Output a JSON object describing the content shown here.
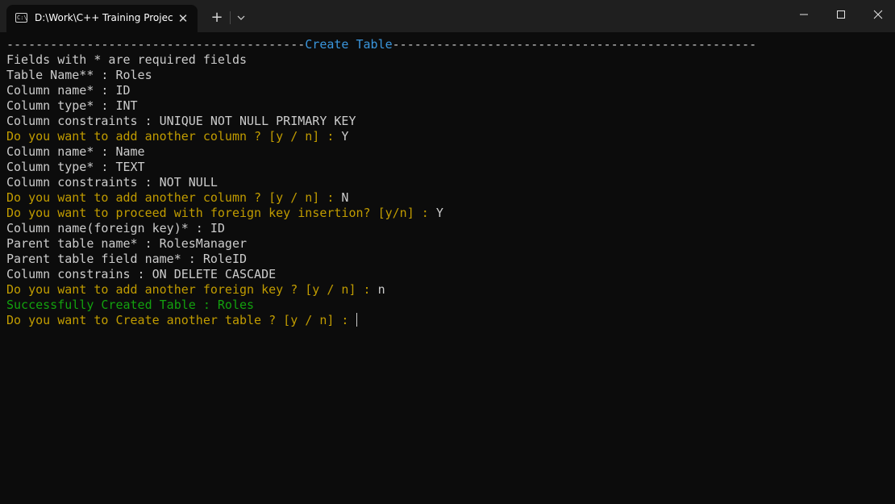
{
  "window": {
    "tab_title": "D:\\Work\\C++ Training Project",
    "tab_icon": "terminal-icon",
    "tab_icon_glyph": "C:\\",
    "close_tab_glyph": "✕",
    "new_tab_glyph": "+",
    "controls": [
      "minimize-icon",
      "maximize-icon",
      "close-icon"
    ]
  },
  "colors": {
    "background": "#0c0c0c",
    "titlebar": "#1f1f1f",
    "text": "#cccccc",
    "prompt_yellow": "#c19c00",
    "success_green": "#13a10e",
    "header_blue": "#3a96dd"
  },
  "terminal": {
    "header": {
      "left_rule": "-----------------------------------------",
      "title": "Create Table",
      "right_rule": "--------------------------------------------------"
    },
    "lines": [
      {
        "label": "Fields with * are required fields",
        "value": ""
      },
      {
        "label": "Table Name** : ",
        "value": "Roles"
      },
      {
        "label": "Column name* : ",
        "value": "ID"
      },
      {
        "label": "Column type* : ",
        "value": "INT"
      },
      {
        "label": "Column constraints : ",
        "value": "UNIQUE NOT NULL PRIMARY KEY"
      },
      {
        "label": "Do you want to add another column ? [y / n] : ",
        "value": "Y"
      },
      {
        "label": "Column name* : ",
        "value": "Name"
      },
      {
        "label": "Column type* : ",
        "value": "TEXT"
      },
      {
        "label": "Column constraints : ",
        "value": "NOT NULL"
      },
      {
        "label": "Do you want to add another column ? [y / n] : ",
        "value": "N"
      },
      {
        "label": "Do you want to proceed with foreign key insertion? [y/n] : ",
        "value": "Y"
      },
      {
        "label": "Column name(foreign key)* : ",
        "value": "ID"
      },
      {
        "label": "Parent table name* : ",
        "value": "RolesManager"
      },
      {
        "label": "Parent table field name* : ",
        "value": "RoleID"
      },
      {
        "label": "Column constrains : ",
        "value": "ON DELETE CASCADE"
      },
      {
        "label": "Do you want to add another foreign key ? [y / n] : ",
        "value": "n"
      },
      {
        "label": "Successfully Created Table : Roles",
        "value": ""
      },
      {
        "label": "Do you want to Create another table ? [y / n] : ",
        "value": ""
      }
    ]
  }
}
